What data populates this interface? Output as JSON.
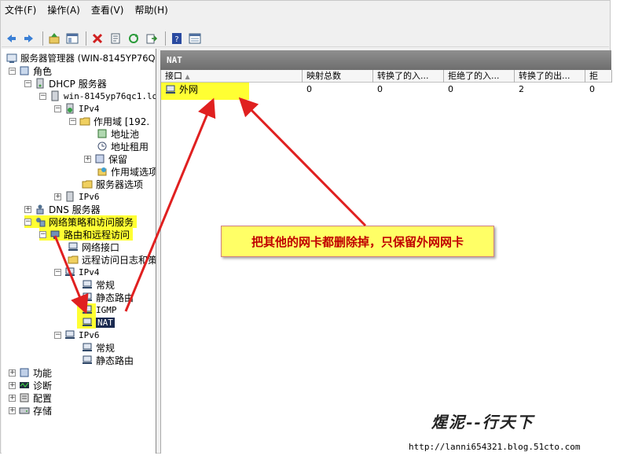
{
  "menu": {
    "file": "文件(F)",
    "action": "操作(A)",
    "view": "查看(V)",
    "help": "帮助(H)"
  },
  "toolbar_icons": [
    "back-icon",
    "forward-icon",
    "up-icon",
    "show-hide-tree-icon",
    "delete-icon",
    "properties-icon",
    "refresh-icon",
    "export-icon",
    "help-icon",
    "view-icon"
  ],
  "tree": {
    "server_manager": "服务器管理器 (WIN-8145YP76QC",
    "roles": "角色",
    "dhcp_server": "DHCP 服务器",
    "host": "win-8145yp76qc1.loc",
    "ipv4": "IPv4",
    "scope": "作用域 [192.",
    "address_pool": "地址池",
    "address_lease": "地址租用",
    "reservation": "保留",
    "scope_options": "作用域选项",
    "server_options": "服务器选项",
    "ipv6": "IPv6",
    "dns_server": "DNS 服务器",
    "nps": "网络策略和访问服务",
    "rras": "路由和远程访问",
    "network_interfaces": "网络接口",
    "remote_access_log": "远程访问日志和策",
    "ipv4_routing": "IPv4",
    "general": "常规",
    "static_routes": "静态路由",
    "igmp": "IGMP",
    "nat": "NAT",
    "ipv6_routing": "IPv6",
    "general6": "常规",
    "static_routes6": "静态路由",
    "features": "功能",
    "diagnostics": "诊断",
    "configuration": "配置",
    "storage": "存储"
  },
  "pane": {
    "title": "NAT",
    "columns": [
      "接口",
      "映射总数",
      "转换了的入...",
      "拒绝了的入...",
      "转换了的出...",
      "拒"
    ],
    "rows": [
      {
        "interface": "外网",
        "mappings": "0",
        "in_translated": "0",
        "in_rejected": "0",
        "out_translated": "2",
        "out_rejected": "0"
      }
    ]
  },
  "callout": "把其他的网卡都删除掉，只保留外网网卡",
  "signature": "煋泥--行天下",
  "watermark": "http://lanni654321.blog.51cto.com",
  "colors": {
    "highlight": "#ffff33",
    "arrow": "#e02020",
    "callout_text": "#c00000",
    "header_bg": "#7a7a7a"
  }
}
